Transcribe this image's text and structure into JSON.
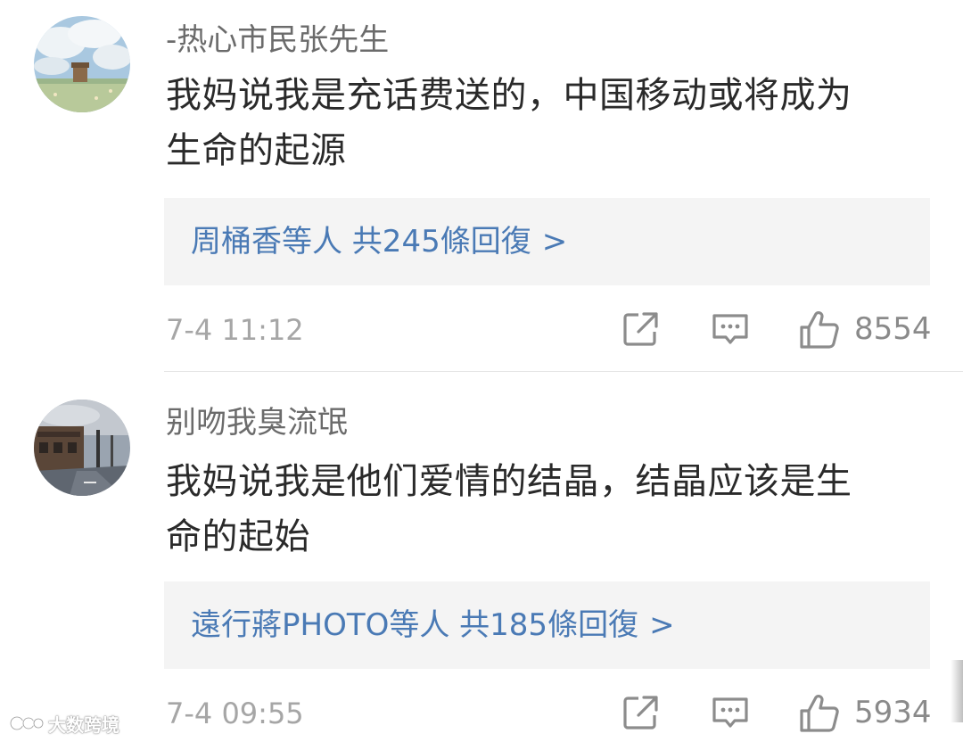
{
  "comments": [
    {
      "username": "-热心市民张先生",
      "text_line1": "我妈说我是充话费送的，中国移动或将成为",
      "text_line2": "生命的起源",
      "replies_text": "周桶香等人 共245條回復",
      "replies_arrow": ">",
      "timestamp": "7-4 11:12",
      "likes": "8554"
    },
    {
      "username": "别吻我臭流氓",
      "text_line1": "我妈说我是他们爱情的结晶，结晶应该是生",
      "text_line2": "命的起始",
      "replies_text": "遠行蔣PHOTO等人 共185條回復",
      "replies_arrow": ">",
      "timestamp": "7-4 09:55",
      "likes": "5934"
    }
  ],
  "icons": {
    "share": "share-icon",
    "comment": "comment-icon",
    "like": "thumbs-up-icon"
  },
  "colors": {
    "link": "#4a7ab5",
    "reply_bg": "#f4f4f4",
    "meta": "#a6a6a6",
    "text": "#2a2a2a"
  },
  "watermark": {
    "text": "大数跨境"
  }
}
